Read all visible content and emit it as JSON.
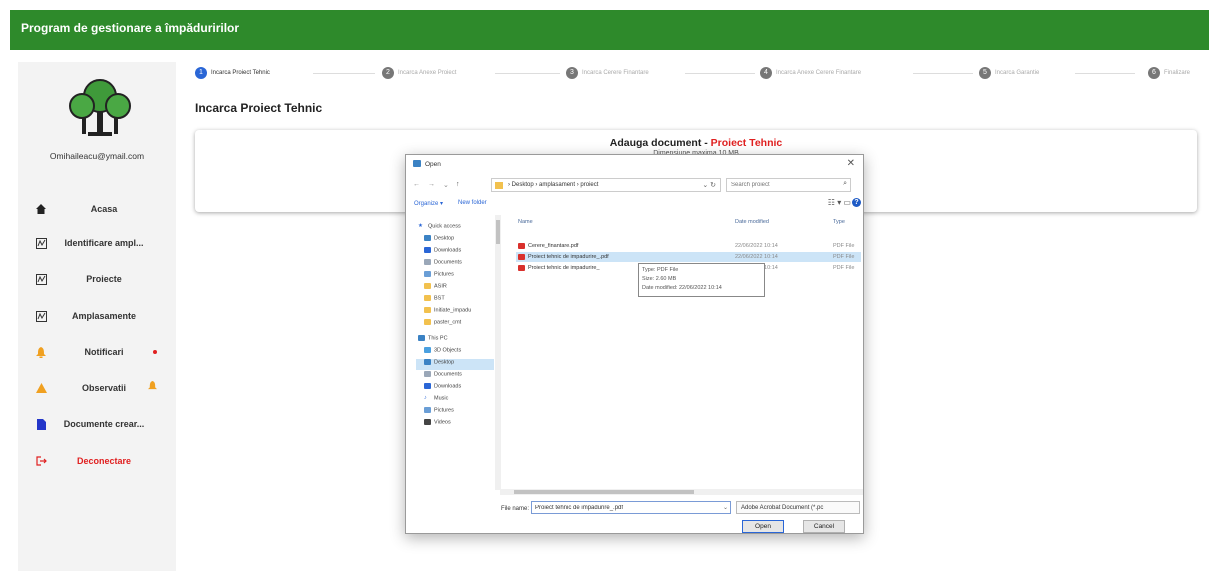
{
  "app": {
    "title": "Program de gestionare a împăduririlor",
    "brand_color": "#2e8a2b"
  },
  "sidebar": {
    "logo_icon": "trees-logo-icon",
    "user_email": "Omihaileacu@ymail.com",
    "items": [
      {
        "label": "Acasa",
        "icon": "home-icon"
      },
      {
        "label": "Identificare ampl...",
        "icon": "map-icon"
      },
      {
        "label": "Proiecte",
        "icon": "map-icon"
      },
      {
        "label": "Amplasamente",
        "icon": "map-icon"
      },
      {
        "label": "Notificari",
        "icon": "bell-icon"
      },
      {
        "label": "Observatii",
        "icon": "warning-icon"
      },
      {
        "label": "Documente crear...",
        "icon": "document-icon"
      },
      {
        "label": "Deconectare",
        "icon": "logout-icon"
      }
    ]
  },
  "stepper": {
    "active_color": "#2a66d6",
    "steps": [
      {
        "num": "1",
        "label": "Incarca Proiect Tehnic"
      },
      {
        "num": "2",
        "label": "Incarca Anexe Proiect"
      },
      {
        "num": "3",
        "label": "Incarca Cerere Finantare"
      },
      {
        "num": "4",
        "label": "Incarca Anexe Cerere Finantare"
      },
      {
        "num": "5",
        "label": "Incarca Garantie"
      },
      {
        "num": "6",
        "label": "Finalizare"
      }
    ]
  },
  "main": {
    "title": "Incarca Proiect Tehnic",
    "card_title": "Adauga document - ",
    "card_title_accent": "Proiect Tehnic",
    "card_subtitle": "Dimensiune maxima 10 MB"
  },
  "dialog": {
    "title": "Open",
    "path": [
      "Desktop",
      "amplasament",
      "proiect"
    ],
    "search_placeholder": "Search proiect",
    "commands": {
      "organize": "Organize ▾",
      "new_folder": "New folder"
    },
    "nav_items": [
      {
        "label": "Quick access",
        "icon": "star-icon"
      },
      {
        "label": "Desktop",
        "icon": "desktop-icon"
      },
      {
        "label": "Downloads",
        "icon": "download-icon"
      },
      {
        "label": "Documents",
        "icon": "documents-icon"
      },
      {
        "label": "Pictures",
        "icon": "pictures-icon"
      },
      {
        "label": "ASIR",
        "icon": "folder-icon"
      },
      {
        "label": "BST",
        "icon": "folder-icon"
      },
      {
        "label": "Initiate_impadu",
        "icon": "folder-icon"
      },
      {
        "label": "paster_cmt",
        "icon": "folder-icon"
      },
      {
        "label": "This PC",
        "icon": "pc-icon"
      },
      {
        "label": "3D Objects",
        "icon": "cube-icon"
      },
      {
        "label": "Desktop",
        "icon": "desktop-icon"
      },
      {
        "label": "Documents",
        "icon": "documents-icon"
      },
      {
        "label": "Downloads",
        "icon": "download-icon"
      },
      {
        "label": "Music",
        "icon": "music-icon"
      },
      {
        "label": "Pictures",
        "icon": "pictures-icon"
      },
      {
        "label": "Videos",
        "icon": "video-icon"
      }
    ],
    "columns": {
      "name": "Name",
      "date": "Date modified",
      "type": "Type"
    },
    "files": [
      {
        "name": "Cerere_finantare.pdf",
        "date": "22/06/2022 10:14",
        "type": "PDF File"
      },
      {
        "name": "Proiect tehnic de impadurire_.pdf",
        "date": "22/06/2022 10:14",
        "type": "PDF File"
      },
      {
        "name": "Proiect tehnic de impadurire_",
        "date": "22/06/2022 10:14",
        "type": "PDF File"
      }
    ],
    "tooltip": [
      "Type: PDF File",
      "Size: 2.60 MB",
      "Date modified: 22/06/2022 10:14"
    ],
    "filename_label": "File name:",
    "filename_value": "Proiect tehnic de impadurire_.pdf",
    "filetype": "Adobe Acrobat Document (*.pc",
    "open_label": "Open",
    "cancel_label": "Cancel"
  }
}
